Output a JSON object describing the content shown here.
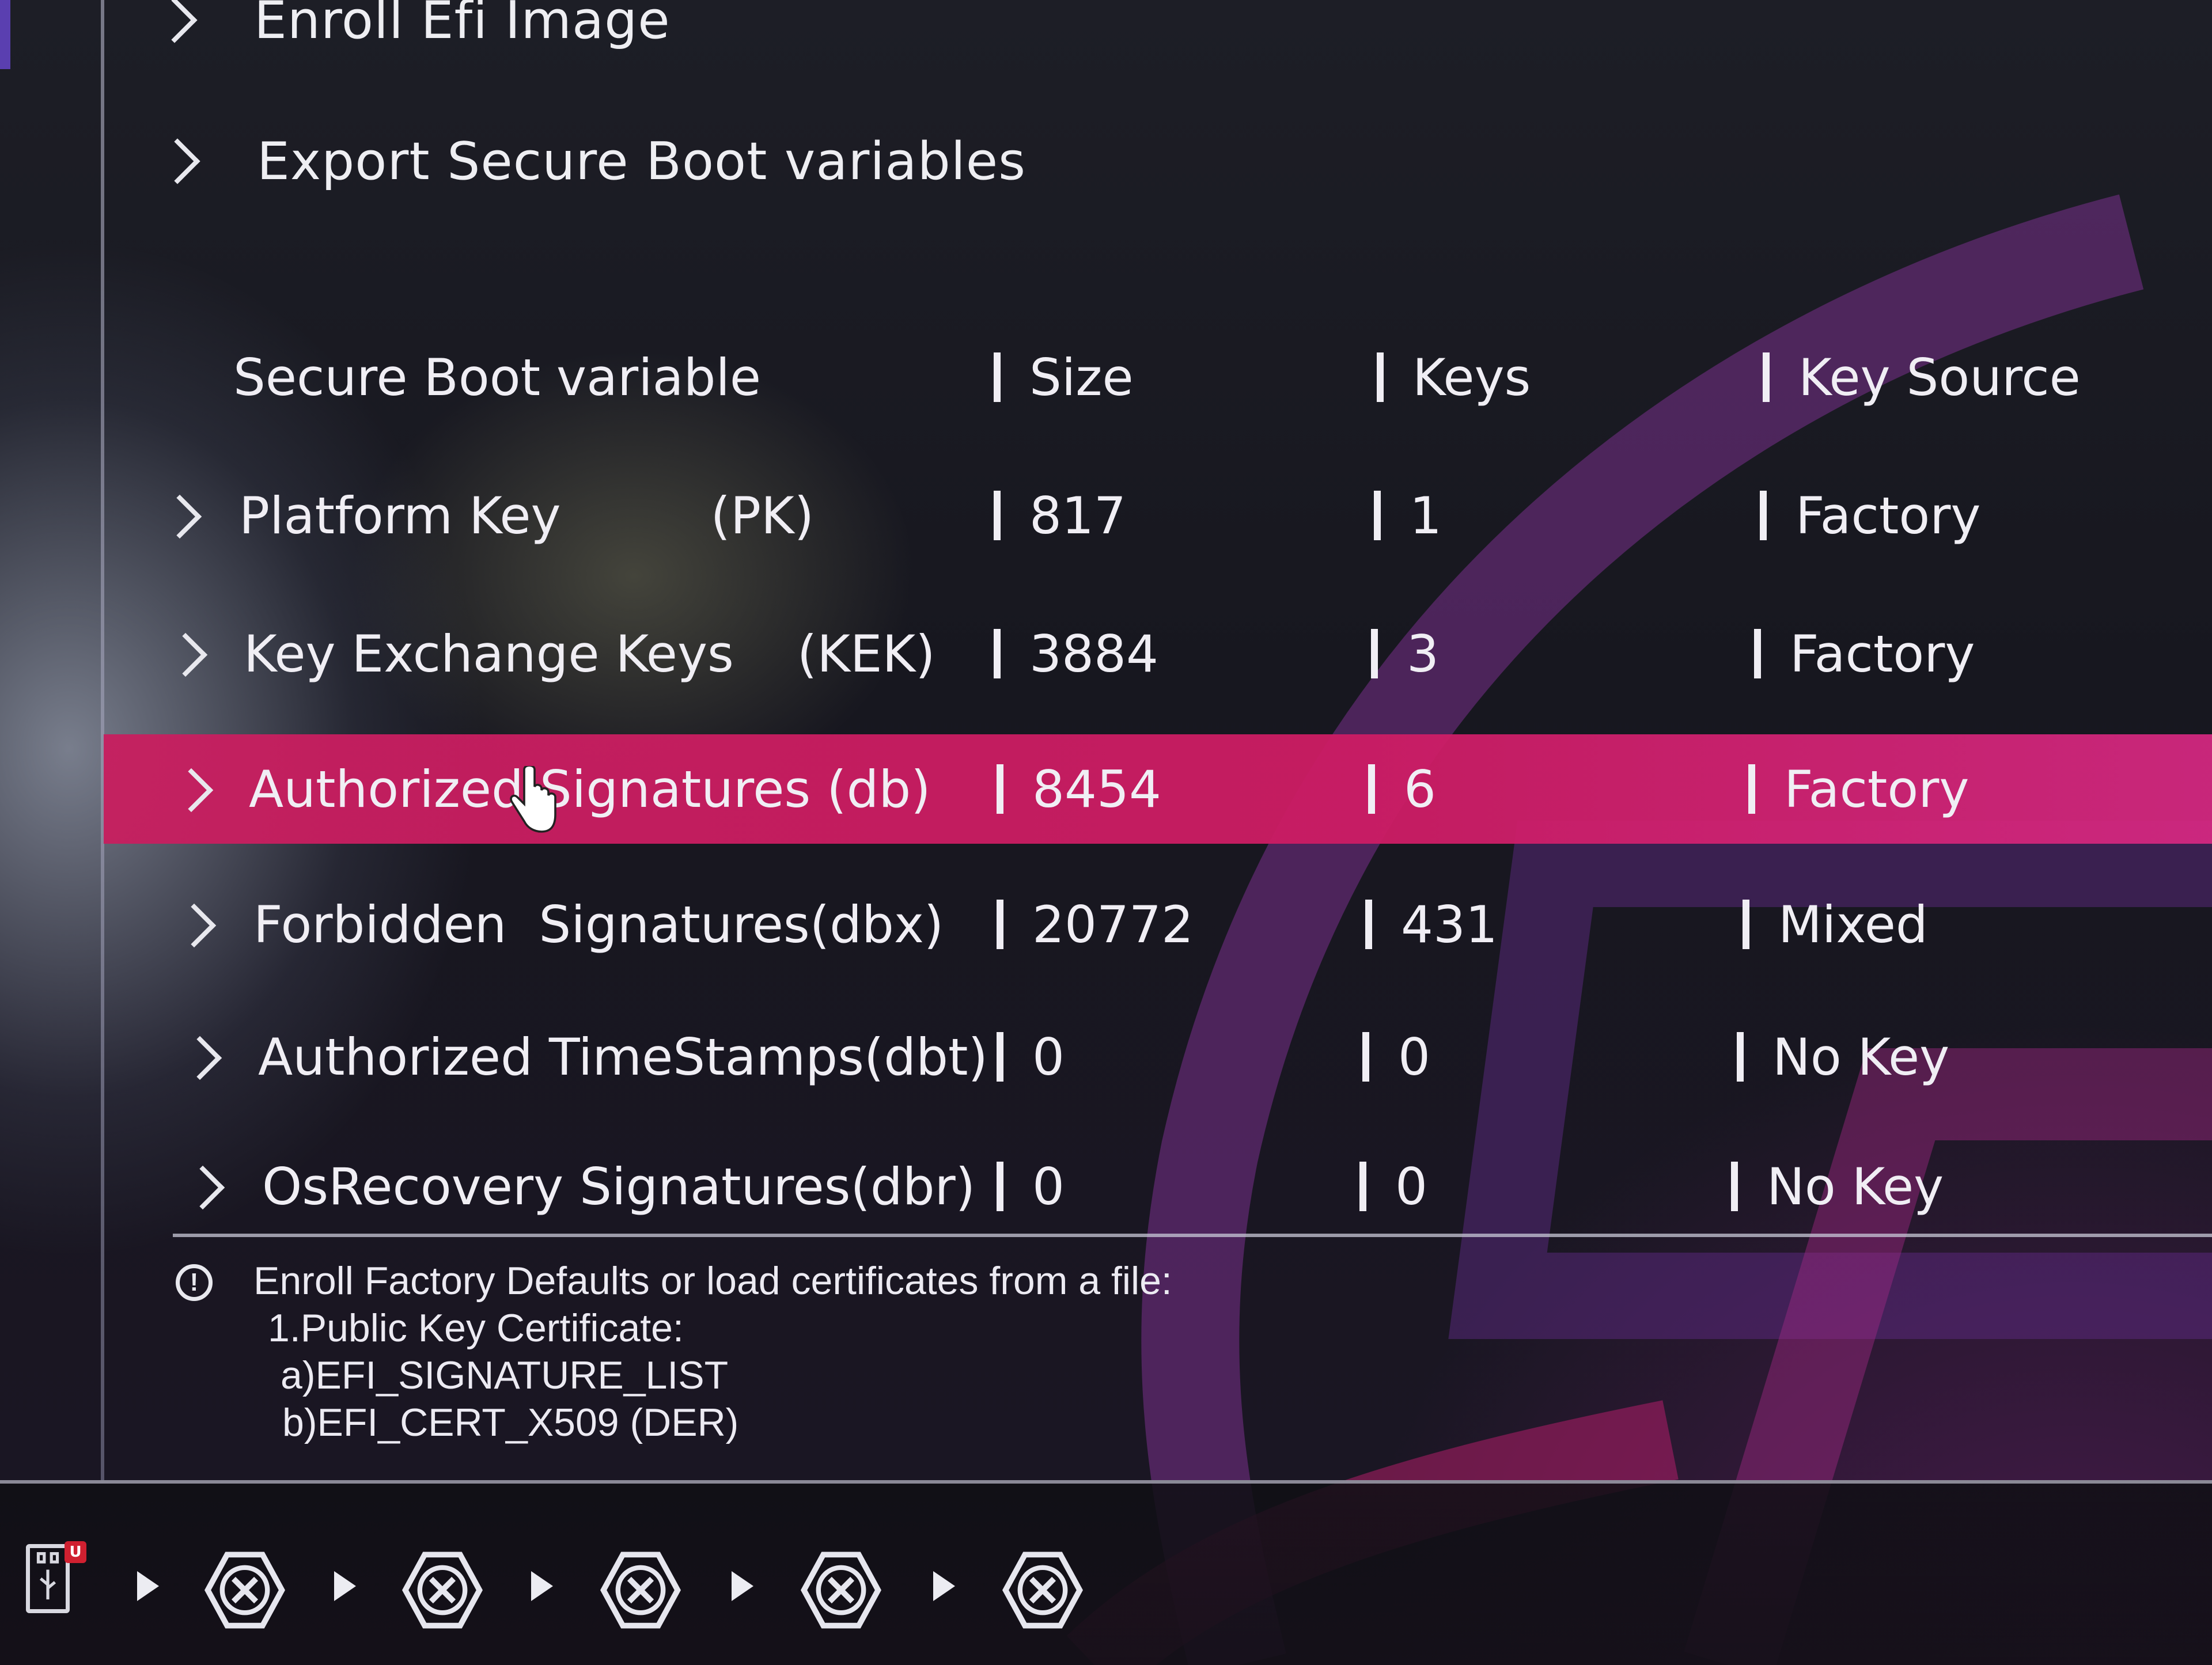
{
  "menu": [
    {
      "label": "Enroll Efi Image"
    },
    {
      "label": "Export Secure Boot variables"
    }
  ],
  "table": {
    "headers": [
      "Secure Boot variable",
      "Size",
      "Keys",
      "Key Source"
    ],
    "rows": [
      {
        "name": "Platform Key",
        "abbr": "(PK)",
        "size": "817",
        "keys": "1",
        "source": "Factory"
      },
      {
        "name": "Key Exchange Keys",
        "abbr": "(KEK)",
        "size": "3884",
        "keys": "3",
        "source": "Factory"
      },
      {
        "name": "Authorized Signatures (db)",
        "abbr": "",
        "size": "8454",
        "keys": "6",
        "source": "Factory"
      },
      {
        "name": "Forbidden  Signatures(dbx)",
        "abbr": "",
        "size": "20772",
        "keys": "431",
        "source": "Mixed"
      },
      {
        "name": "Authorized TimeStamps(dbt)",
        "abbr": "",
        "size": "0",
        "keys": "0",
        "source": "No Key"
      },
      {
        "name": "OsRecovery Signatures(dbr)",
        "abbr": "",
        "size": "0",
        "keys": "0",
        "source": "No Key"
      }
    ],
    "selected_row": "Authorized Signatures (db)"
  },
  "info": {
    "lines": [
      "Enroll Factory Defaults or load certificates from a file:",
      "1.Public Key Certificate:",
      "a)EFI_SIGNATURE_LIST",
      "b)EFI_CERT_X509 (DER)"
    ]
  },
  "boot_bar": {
    "usb_badge": "U",
    "devices": [
      "unavailable",
      "unavailable",
      "unavailable",
      "unavailable",
      "unavailable"
    ]
  },
  "colors": {
    "selected_row": "#cc1f62",
    "accent_purple": "#5a3fb0"
  }
}
